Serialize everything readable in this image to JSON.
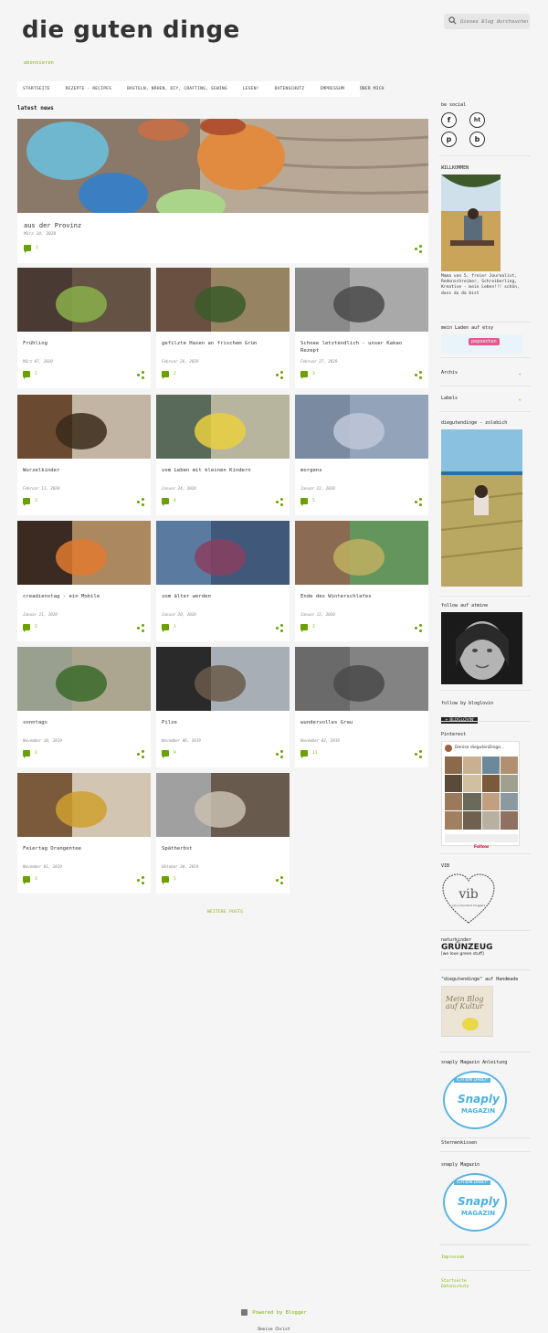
{
  "site": {
    "title": "die guten dinge",
    "subtitle": "abonnieren"
  },
  "search": {
    "placeholder": "Dieses Blog durchsuchen"
  },
  "nav": [
    "STARTSEITE",
    "REZEPTE - RECIPES",
    "BASTELN, NÄHEN, DIY, CRAFTING, SEWING",
    "LESEN!",
    "DATENSCHUTZ",
    "IMPRESSUM",
    "ÜBER MICH"
  ],
  "main": {
    "section_title": "latest news",
    "more_posts": "WEITERE POSTS"
  },
  "hero": {
    "title": "aus der Provinz",
    "date": "März 10, 2020",
    "comments": "2"
  },
  "posts": [
    {
      "title": "Frühling",
      "date": "März 07, 2020",
      "comments": "2"
    },
    {
      "title": "gefilzte Hasen an frischem Grün",
      "date": "Februar 26, 2020",
      "comments": "2"
    },
    {
      "title": "Schnee letztendlich - unser Kakao Rezept",
      "date": "Februar 27, 2020",
      "comments": "3"
    },
    {
      "title": "Wurzelkinder",
      "date": "Februar 13, 2020",
      "comments": "3"
    },
    {
      "title": "vom Leben mit kleinen Kindern",
      "date": "Januar 24, 2020",
      "comments": "4"
    },
    {
      "title": "morgens",
      "date": "Januar 23, 2020",
      "comments": "5"
    },
    {
      "title": "creadienstag - ein Mobile",
      "date": "Januar 21, 2020",
      "comments": "2"
    },
    {
      "title": "vom älter werden",
      "date": "Januar 20, 2020",
      "comments": "1"
    },
    {
      "title": "Ende des Winterschlafes",
      "date": "Januar 13, 2020",
      "comments": "2"
    },
    {
      "title": "sonntags",
      "date": "November 10, 2019",
      "comments": "3"
    },
    {
      "title": "Pilze",
      "date": "November 06, 2019",
      "comments": "9"
    },
    {
      "title": "wundervolles Grau",
      "date": "November 02, 2019",
      "comments": "11"
    },
    {
      "title": "Feiertag Orangentee",
      "date": "November 01, 2019",
      "comments": "3"
    },
    {
      "title": "Spätherbst",
      "date": "Oktober 30, 2019",
      "comments": "5"
    }
  ],
  "sidebar": {
    "social_title": "be social",
    "social_icons": [
      "f",
      "ht",
      "p",
      "b"
    ],
    "welcome_title": "WILLKOMMEN",
    "welcome_text": "Mama von 5, freier Journalist, Redenschreiber, Schreiberling, Kreative - mein Leben!!! schön, dass du da bist",
    "shop_title": "mein Laden auf etsy",
    "shop_badge": "pepoechen",
    "archive": "Archiv",
    "labels": "Labels",
    "instagram_title": "diegutendinge - zolebich",
    "follow_title": "follow auf atmine",
    "bloglovin_title": "follow by bloglovin",
    "bloglovin_badge": "+ BLOGLOVIN'",
    "pinterest_title": "Pinterest",
    "pinterest_user": "Denise diegutenDinge...",
    "pinterest_follow": "Follow",
    "vib_title": "VIB",
    "vib_logo": "vib",
    "vib_text": "very important bloggers",
    "gruenzeug_title": "naturkinder",
    "gruenzeug_logo": "GRÜNZEUG",
    "gruenzeug_sub": "[we love green stuff]",
    "handmade_title": "\"diegutendinge\" auf Handmade",
    "handmade_badge": "Mein Blog auf Kultur",
    "snaply1_title": "snaply Magazin Anleitung",
    "snaply_ribbon": "ICH BIN DABEI!",
    "snaply_name": "Snaply",
    "snaply_sub": "MAGAZIN",
    "sterne_title": "Sternenkissen",
    "snaply2_title": "snaply Magazin",
    "impressum": "Impressum",
    "links": [
      "Startseite",
      "Datenschutz"
    ]
  },
  "footer": {
    "powered": "Powered by Blogger",
    "author": "Denise Christ"
  }
}
